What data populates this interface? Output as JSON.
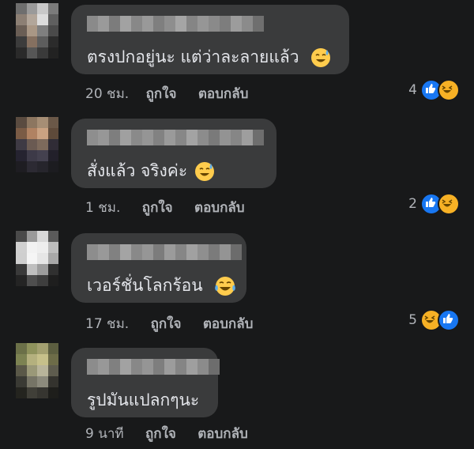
{
  "comments": [
    {
      "text": "ตรงปกอยู่นะ แต่ว่าละลายแล้ว",
      "emoji": "sweat-smile",
      "time": "20 ชม.",
      "like_label": "ถูกใจ",
      "reply_label": "ตอบกลับ",
      "reaction_count": "4",
      "reactions": [
        "like",
        "haha"
      ]
    },
    {
      "text": "สั่งแล้ว จริงค่ะ",
      "emoji": "sweat-smile",
      "time": "1 ชม.",
      "like_label": "ถูกใจ",
      "reply_label": "ตอบกลับ",
      "reaction_count": "2",
      "reactions": [
        "like",
        "haha"
      ]
    },
    {
      "text": "เวอร์ชั่นโลกร้อน",
      "emoji": "tears-of-joy",
      "time": "17 ชม.",
      "like_label": "ถูกใจ",
      "reply_label": "ตอบกลับ",
      "reaction_count": "5",
      "reactions": [
        "haha",
        "like"
      ]
    },
    {
      "text": "รูปมันแปลกๆนะ",
      "emoji": "",
      "time": "9 นาที",
      "like_label": "ถูกใจ",
      "reply_label": "ตอบกลับ",
      "reaction_count": "",
      "reactions": []
    }
  ],
  "colors": {
    "background": "#18191a",
    "bubble": "#3a3b3c",
    "text": "#e4e6eb",
    "meta": "#b0b3b8",
    "like": "#1877f2",
    "haha": "#f7b125"
  }
}
